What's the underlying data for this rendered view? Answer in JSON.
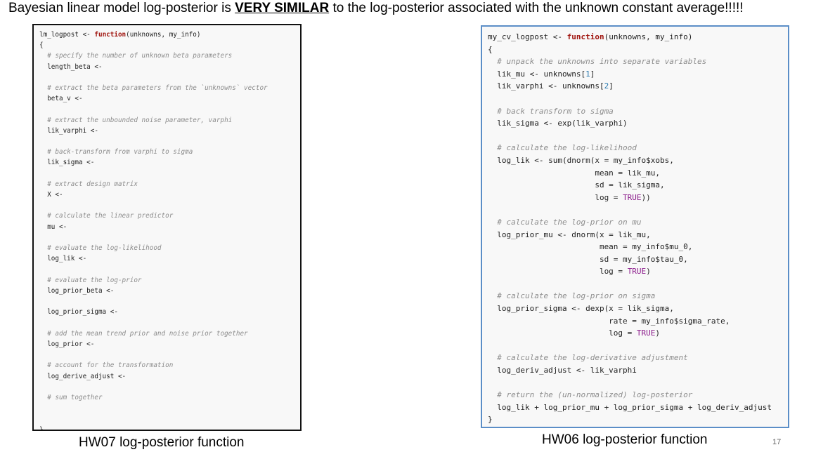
{
  "headline": {
    "before": "Bayesian linear model log-posterior is ",
    "emphasis": "VERY SIMILAR",
    "after": " to the log-posterior associated with the unknown constant average!!!!!"
  },
  "left_code": [
    [
      [
        "lm_logpost <- ",
        ""
      ],
      [
        "function",
        "kw"
      ],
      [
        "(unknowns, my_info)",
        ""
      ]
    ],
    [
      [
        "{",
        ""
      ]
    ],
    [
      [
        "  # specify the number of unknown beta parameters",
        "cm"
      ]
    ],
    [
      [
        "  length_beta <-",
        ""
      ]
    ],
    [],
    [
      [
        "  # extract the beta parameters from the `unknowns` vector",
        "cm"
      ]
    ],
    [
      [
        "  beta_v <-",
        ""
      ]
    ],
    [],
    [
      [
        "  # extract the unbounded noise parameter, varphi",
        "cm"
      ]
    ],
    [
      [
        "  lik_varphi <-",
        ""
      ]
    ],
    [],
    [
      [
        "  # back-transform from varphi to sigma",
        "cm"
      ]
    ],
    [
      [
        "  lik_sigma <-",
        ""
      ]
    ],
    [],
    [
      [
        "  # extract design matrix",
        "cm"
      ]
    ],
    [
      [
        "  X <-",
        ""
      ]
    ],
    [],
    [
      [
        "  # calculate the linear predictor",
        "cm"
      ]
    ],
    [
      [
        "  mu <-",
        ""
      ]
    ],
    [],
    [
      [
        "  # evaluate the log-likelihood",
        "cm"
      ]
    ],
    [
      [
        "  log_lik <-",
        ""
      ]
    ],
    [],
    [
      [
        "  # evaluate the log-prior",
        "cm"
      ]
    ],
    [
      [
        "  log_prior_beta <-",
        ""
      ]
    ],
    [],
    [
      [
        "  log_prior_sigma <-",
        ""
      ]
    ],
    [],
    [
      [
        "  # add the mean trend prior and noise prior together",
        "cm"
      ]
    ],
    [
      [
        "  log_prior <-",
        ""
      ]
    ],
    [],
    [
      [
        "  # account for the transformation",
        "cm"
      ]
    ],
    [
      [
        "  log_derive_adjust <-",
        ""
      ]
    ],
    [],
    [
      [
        "  # sum together",
        "cm"
      ]
    ],
    [],
    [],
    [
      [
        "}",
        ""
      ]
    ]
  ],
  "right_code": [
    [
      [
        "my_cv_logpost <- ",
        ""
      ],
      [
        "function",
        "kw"
      ],
      [
        "(unknowns, my_info)",
        ""
      ]
    ],
    [
      [
        "{",
        ""
      ]
    ],
    [
      [
        "  # unpack the unknowns into separate variables",
        "cm"
      ]
    ],
    [
      [
        "  lik_mu <- unknowns[",
        ""
      ],
      [
        "1",
        "num"
      ],
      [
        "]",
        ""
      ]
    ],
    [
      [
        "  lik_varphi <- unknowns[",
        ""
      ],
      [
        "2",
        "num"
      ],
      [
        "]",
        ""
      ]
    ],
    [],
    [
      [
        "  # back transform to sigma",
        "cm"
      ]
    ],
    [
      [
        "  lik_sigma <- exp(lik_varphi)",
        ""
      ]
    ],
    [],
    [
      [
        "  # calculate the log-likelihood",
        "cm"
      ]
    ],
    [
      [
        "  log_lik <- sum(dnorm(x = my_info$xobs,",
        ""
      ]
    ],
    [
      [
        "                       mean = lik_mu,",
        ""
      ]
    ],
    [
      [
        "                       sd = lik_sigma,",
        ""
      ]
    ],
    [
      [
        "                       log = ",
        ""
      ],
      [
        "TRUE",
        "lit"
      ],
      [
        "))",
        ""
      ]
    ],
    [],
    [
      [
        "  # calculate the log-prior on mu",
        "cm"
      ]
    ],
    [
      [
        "  log_prior_mu <- dnorm(x = lik_mu,",
        ""
      ]
    ],
    [
      [
        "                        mean = my_info$mu_0,",
        ""
      ]
    ],
    [
      [
        "                        sd = my_info$tau_0,",
        ""
      ]
    ],
    [
      [
        "                        log = ",
        ""
      ],
      [
        "TRUE",
        "lit"
      ],
      [
        ")",
        ""
      ]
    ],
    [],
    [
      [
        "  # calculate the log-prior on sigma",
        "cm"
      ]
    ],
    [
      [
        "  log_prior_sigma <- dexp(x = lik_sigma,",
        ""
      ]
    ],
    [
      [
        "                          rate = my_info$sigma_rate,",
        ""
      ]
    ],
    [
      [
        "                          log = ",
        ""
      ],
      [
        "TRUE",
        "lit"
      ],
      [
        ")",
        ""
      ]
    ],
    [],
    [
      [
        "  # calculate the log-derivative adjustment",
        "cm"
      ]
    ],
    [
      [
        "  log_deriv_adjust <- lik_varphi",
        ""
      ]
    ],
    [],
    [
      [
        "  # return the (un-normalized) log-posterior",
        "cm"
      ]
    ],
    [
      [
        "  log_lik + log_prior_mu + log_prior_sigma + log_deriv_adjust",
        ""
      ]
    ],
    [
      [
        "}",
        ""
      ]
    ]
  ],
  "captions": {
    "left": "HW07 log-posterior function",
    "right": "HW06 log-posterior function"
  },
  "slide_number": "17",
  "colors": {
    "left_border": "#111111",
    "right_border": "#5b8ec7",
    "keyword": "#a0150f",
    "comment": "#8c8c8c",
    "number": "#2a7ab0",
    "literal": "#8b1a8b"
  }
}
